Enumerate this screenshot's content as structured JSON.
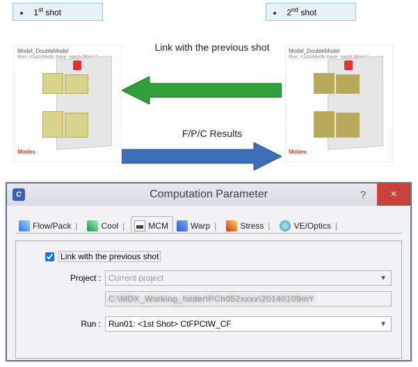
{
  "labels": {
    "shot1_prefix": "1",
    "shot1_ord": "st",
    "shot1_word": " shot",
    "shot2_prefix": "2",
    "shot2_ord": "nd",
    "shot2_word": " shot"
  },
  "arrows": {
    "link_text": "Link with the previous shot",
    "fpc_text": "F/P/C Results"
  },
  "model": {
    "title": "Model_DoubleModel",
    "sub": "Run: <1st>Mesh: base_mesh (Basic)",
    "bottom": "Moldex"
  },
  "dialog": {
    "app_icon_letter": "C",
    "title": "Computation Parameter",
    "help": "?",
    "close": "×"
  },
  "tabs": {
    "flow": "Flow/Pack",
    "cool": "Cool",
    "mcm": "MCM",
    "warp": "Warp",
    "stress": "Stress",
    "ve": "VE/Optics"
  },
  "form": {
    "checkbox_label": "Link with the previous shot",
    "project_label": "Project :",
    "project_value": "Current project",
    "path_value": "C:\\MDX_Working_folder\\PCh052xxxx\\20140109mY",
    "run_label": "Run :",
    "run_value": "Run01: <1st Shot> CtFPCtW_CF"
  }
}
